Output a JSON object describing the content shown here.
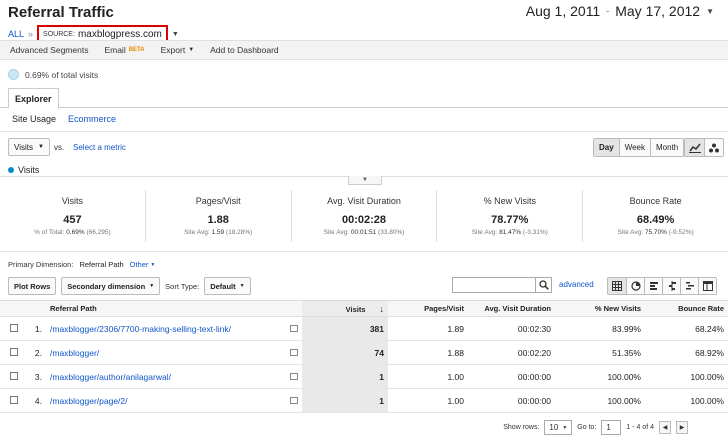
{
  "report": {
    "title": "Referral Traffic",
    "breadcrumb_all": "ALL",
    "breadcrumb_sep": "»",
    "source_label": "Source:",
    "source_value": "maxblogpress.com"
  },
  "date_range": {
    "start": "Aug 1, 2011",
    "sep": "-",
    "end": "May 17, 2012"
  },
  "toolbar": {
    "advanced_segments": "Advanced Segments",
    "email": "Email",
    "email_badge": "BETA",
    "export": "Export",
    "add_to_dashboard": "Add to Dashboard"
  },
  "segment": {
    "label": "0.69% of total visits"
  },
  "tabs": {
    "explorer": "Explorer",
    "site_usage": "Site Usage",
    "ecommerce": "Ecommerce"
  },
  "chart_controls": {
    "metric": "Visits",
    "vs": "vs.",
    "select_metric": "Select a metric",
    "day": "Day",
    "week": "Week",
    "month": "Month"
  },
  "legend": {
    "series": "Visits",
    "color": "#058dc7"
  },
  "scorecards": [
    {
      "name": "Visits",
      "value": "457",
      "sub_label": "% of Total:",
      "sub_value": "0.69%",
      "sub_extra": "(66,295)"
    },
    {
      "name": "Pages/Visit",
      "value": "1.88",
      "sub_label": "Site Avg:",
      "sub_value": "1.59",
      "sub_extra": "(18.28%)"
    },
    {
      "name": "Avg. Visit Duration",
      "value": "00:02:28",
      "sub_label": "Site Avg:",
      "sub_value": "00:01:51",
      "sub_extra": "(33.80%)"
    },
    {
      "name": "% New Visits",
      "value": "78.77%",
      "sub_label": "Site Avg:",
      "sub_value": "81.47%",
      "sub_extra": "(-3.31%)"
    },
    {
      "name": "Bounce Rate",
      "value": "68.49%",
      "sub_label": "Site Avg:",
      "sub_value": "75.70%",
      "sub_extra": "(-9.52%)"
    }
  ],
  "dimension": {
    "label": "Primary Dimension:",
    "value": "Referral Path",
    "other": "Other"
  },
  "table_controls": {
    "plot_rows": "Plot Rows",
    "secondary_dimension": "Secondary dimension",
    "sort_type_label": "Sort Type:",
    "sort_type_value": "Default",
    "advanced": "advanced"
  },
  "table": {
    "headers": {
      "path": "Referral Path",
      "visits": "Visits",
      "pages": "Pages/Visit",
      "duration": "Avg. Visit Duration",
      "new": "% New Visits",
      "bounce": "Bounce Rate"
    },
    "rows": [
      {
        "idx": "1.",
        "path": "/maxblogger/2306/7700-making-selling-text-link/",
        "visits": "381",
        "pages": "1.89",
        "duration": "00:02:30",
        "new": "83.99%",
        "bounce": "68.24%"
      },
      {
        "idx": "2.",
        "path": "/maxblogger/",
        "visits": "74",
        "pages": "1.88",
        "duration": "00:02:20",
        "new": "51.35%",
        "bounce": "68.92%"
      },
      {
        "idx": "3.",
        "path": "/maxblogger/author/anilagarwal/",
        "visits": "1",
        "pages": "1.00",
        "duration": "00:00:00",
        "new": "100.00%",
        "bounce": "100.00%"
      },
      {
        "idx": "4.",
        "path": "/maxblogger/page/2/",
        "visits": "1",
        "pages": "1.00",
        "duration": "00:00:00",
        "new": "100.00%",
        "bounce": "100.00%"
      }
    ]
  },
  "pager": {
    "show_rows_label": "Show rows:",
    "show_rows_value": "10",
    "goto_label": "Go to:",
    "goto_value": "1",
    "range": "1 - 4 of 4"
  }
}
